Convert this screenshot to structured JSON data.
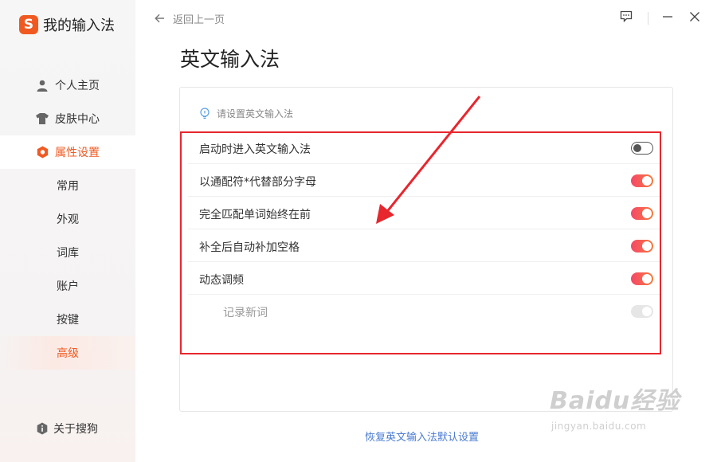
{
  "app": {
    "title": "我的输入法",
    "logo_letter": "S",
    "brand_color": "#f05a22"
  },
  "sidebar": {
    "items": [
      {
        "label": "个人主页",
        "icon": "user-icon"
      },
      {
        "label": "皮肤中心",
        "icon": "shirt-icon"
      },
      {
        "label": "属性设置",
        "icon": "settings-hex-icon"
      }
    ],
    "sub_items": [
      {
        "label": "常用"
      },
      {
        "label": "外观"
      },
      {
        "label": "词库"
      },
      {
        "label": "账户"
      },
      {
        "label": "按键"
      },
      {
        "label": "高级"
      }
    ],
    "active_sub": "高级",
    "about": {
      "label": "关于搜狗",
      "icon": "info-shield-icon"
    }
  },
  "topbar": {
    "back_label": "返回上一页"
  },
  "page": {
    "title": "英文输入法",
    "hint": "请设置英文输入法"
  },
  "settings": [
    {
      "label": "启动时进入英文输入法",
      "state": "off"
    },
    {
      "label": "以通配符*代替部分字母",
      "state": "on"
    },
    {
      "label": "完全匹配单词始终在前",
      "state": "on"
    },
    {
      "label": "补全后自动补加空格",
      "state": "on"
    },
    {
      "label": "动态调频",
      "state": "on"
    },
    {
      "label": "记录新词",
      "state": "disabled"
    }
  ],
  "footer": {
    "restore_label": "恢复英文输入法默认设置"
  },
  "watermark": {
    "brand": "Baidu经验",
    "url": "jingyan.baidu.com"
  },
  "colors": {
    "accent": "#f05a22",
    "toggle_on": "#f5486a",
    "highlight_box": "#e8262d",
    "link": "#4a7bd1"
  }
}
